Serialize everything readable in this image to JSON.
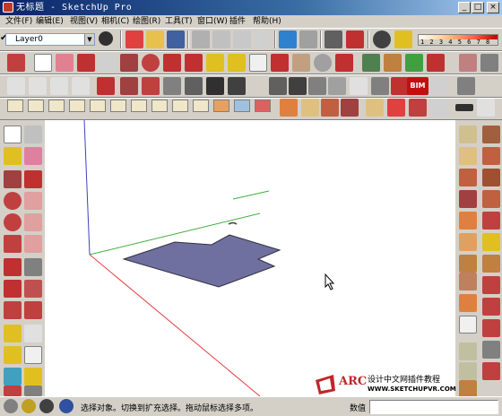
{
  "window": {
    "title": "无标题 - SketchUp Pro"
  },
  "menu": [
    "文件(F)",
    "编辑(E)",
    "视图(V)",
    "相机(C)",
    "绘图(R)",
    "工具(T)",
    "窗口(W)",
    "插件",
    "帮助(H)"
  ],
  "layer": {
    "current": "Layer0"
  },
  "scale_bar": {
    "numbers": "1 2 3 4 5 6 7 8"
  },
  "plugin_tabs": [
    "BIM"
  ],
  "status": {
    "hint": "选择对象。切换到扩充选择。拖动鼠标选择多项。",
    "value_label": "数值",
    "value": ""
  },
  "watermark": {
    "logo": "ARC",
    "title": "设计中文网插件教程",
    "url": "WWW.SKETCHUPVR.COM"
  },
  "colors": {
    "title_bar": "#0a246a",
    "toolbar": "#d4d0c8",
    "face": "#7070a0",
    "x_axis": "#e04040",
    "y_axis": "#40b040",
    "z_axis": "#4040c0"
  }
}
